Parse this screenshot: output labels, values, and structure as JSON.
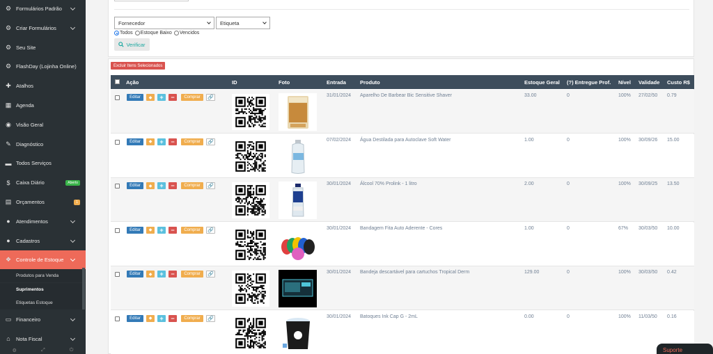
{
  "sidebar": {
    "items": [
      {
        "label": "Formulários Padrão",
        "icon": "gear-cog-icon",
        "chevron": true
      },
      {
        "label": "Criar Formulários",
        "icon": "gear-cog-icon",
        "chevron": true
      },
      {
        "label": "Seu Site",
        "icon": "gear-cog-icon",
        "chevron": false
      },
      {
        "label": "FlashDay (Lojinha Online)",
        "icon": "gear-cog-icon",
        "chevron": false
      },
      {
        "label": "Atalhos",
        "icon": "signpost-icon",
        "chevron": false
      },
      {
        "label": "Agenda",
        "icon": "calendar-icon",
        "chevron": false
      },
      {
        "label": "Visão Geral",
        "icon": "eye-icon",
        "chevron": false
      },
      {
        "label": "Diagnóstico",
        "icon": "diagnosis-icon",
        "chevron": false
      },
      {
        "label": "Todos Serviços",
        "icon": "folder-icon",
        "chevron": false
      },
      {
        "label": "Caixa Diário",
        "icon": "dollar-icon",
        "chevron": false,
        "badge": "Aberto",
        "badge_color": "#3ab54a"
      },
      {
        "label": "Orçamentos",
        "icon": "clipboard-icon",
        "chevron": false,
        "badge": "1",
        "badge_color": "#f0ad4e"
      },
      {
        "label": "Atendimentos",
        "icon": "user-icon",
        "chevron": true
      },
      {
        "label": "Cadastros",
        "icon": "users-icon",
        "chevron": true
      },
      {
        "label": "Controle de Estoque",
        "icon": "boxes-icon",
        "chevron": true,
        "active": true
      }
    ],
    "subitems": [
      {
        "label": "Produtos para Venda"
      },
      {
        "label": "Suprimentos",
        "active": true
      },
      {
        "label": "Etiquetas Estoque"
      }
    ],
    "items_after": [
      {
        "label": "Financeiro",
        "icon": "money-icon",
        "chevron": true
      },
      {
        "label": "Nota Fiscal",
        "icon": "bank-icon",
        "chevron": true
      }
    ]
  },
  "filters": {
    "fornecedor": "Fornecedor",
    "etiqueta": "Etiqueta",
    "radio_todos": "Todos",
    "radio_baixo": "Estoque Baixo",
    "radio_vencidos": "Vencidos",
    "verificar": "Verificar"
  },
  "table": {
    "excluir_label": "Excluir Itens Selecionados",
    "headers": {
      "acao": "Ação",
      "id": "ID",
      "foto": "Foto",
      "entrada": "Entrada",
      "produto": "Produto",
      "estoque": "Estoque Geral",
      "entregue": "(?) Entregue Prof.",
      "nivel": "Nível",
      "validade": "Validade",
      "custo": "Custo R$"
    },
    "buttons": {
      "editar": "Editar",
      "comprar": "Comprar"
    },
    "rows": [
      {
        "entrada": "31/01/2024",
        "produto": "Aparelho De Barbear Bic Sensitive Shaver",
        "estoque": "33.00",
        "entregue": "0",
        "nivel": "100%",
        "validade": "27/02/50",
        "custo": "0.79",
        "photo": "razor-pack"
      },
      {
        "entrada": "07/02/2024",
        "produto": "Água Destilada para Autoclave Soft Water",
        "estoque": "1.00",
        "entregue": "0",
        "nivel": "100%",
        "validade": "30/09/26",
        "custo": "15.00",
        "photo": "water-bottle"
      },
      {
        "entrada": "30/01/2024",
        "produto": "Álcool 70% Prolink - 1 litro",
        "estoque": "2.00",
        "entregue": "0",
        "nivel": "100%",
        "validade": "30/09/25",
        "custo": "13.50",
        "photo": "alcohol-bottle"
      },
      {
        "entrada": "30/01/2024",
        "produto": "Bandagem Fita Auto Aderente - Cores",
        "estoque": "1.00",
        "entregue": "0",
        "nivel": "67%",
        "validade": "30/03/50",
        "custo": "10.00",
        "photo": "bandage-rolls"
      },
      {
        "entrada": "30/01/2024",
        "produto": "Bandeja descartável para cartuchos Tropical Derm",
        "estoque": "129.00",
        "entregue": "0",
        "nivel": "100%",
        "validade": "30/03/50",
        "custo": "0.42",
        "photo": "tray-box"
      },
      {
        "entrada": "30/01/2024",
        "produto": "Batoques Ink Cap G - 2mL",
        "estoque": "0.00",
        "entregue": "0",
        "nivel": "100%",
        "validade": "11/03/50",
        "custo": "0.16",
        "photo": "ink-cap-pot"
      }
    ]
  },
  "suporte_label": "Suporte"
}
